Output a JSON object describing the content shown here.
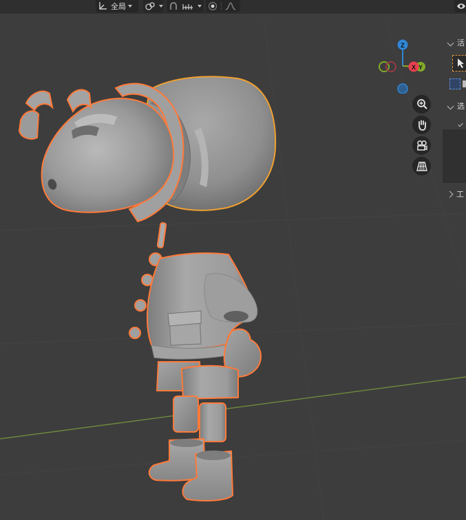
{
  "header": {
    "transform_orientation": "全局",
    "icons": [
      "transform-orientation-icon",
      "pivot-point-icon",
      "snap-icon",
      "snap-increment-icon",
      "proportional-editing-icon",
      "proportional-falloff-icon",
      "visibility-icon"
    ]
  },
  "gizmo": {
    "z_label": "Z",
    "x_label": "X",
    "y_label": "Y",
    "colors": {
      "x": "#e8404f",
      "y": "#83ab2a",
      "z": "#2f86d6"
    }
  },
  "nav_buttons": [
    "zoom-icon",
    "pan-hand-icon",
    "camera-view-icon",
    "perspective-grid-icon"
  ],
  "sidebar": {
    "section_active": "活",
    "section_select": "选",
    "section_tool": "工"
  },
  "scene": {
    "object": "character-mesh",
    "selection_outline_color": "#ff7a3a",
    "active_outline_color": "#f0a030",
    "x_axis_line_color": "#6f8b3d"
  }
}
